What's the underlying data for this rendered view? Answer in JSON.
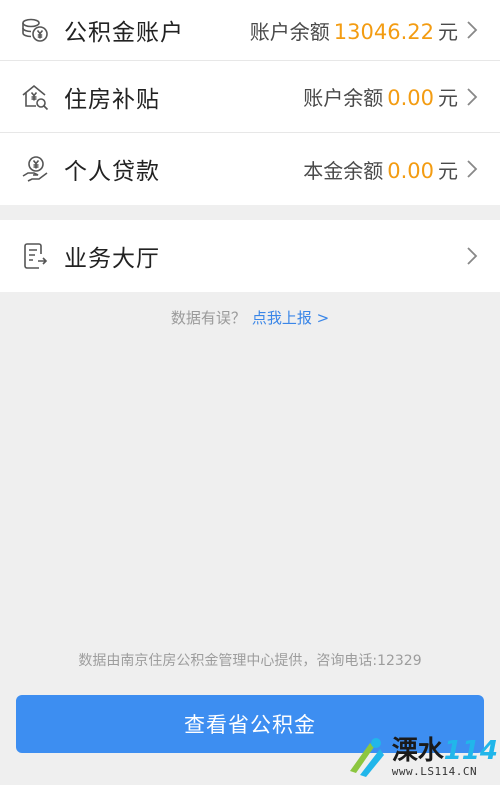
{
  "accounts": [
    {
      "icon": "coins-icon",
      "label": "公积金账户",
      "right_label": "账户余额",
      "amount": "13046.22",
      "unit": "元"
    },
    {
      "icon": "house-subsidy-icon",
      "label": "住房补贴",
      "right_label": "账户余额",
      "amount": "0.00",
      "unit": "元"
    },
    {
      "icon": "loan-hand-icon",
      "label": "个人贷款",
      "right_label": "本金余额",
      "amount": "0.00",
      "unit": "元"
    }
  ],
  "service_hall": {
    "icon": "document-icon",
    "label": "业务大厅"
  },
  "report": {
    "prompt": "数据有误？",
    "link": "点我上报 >"
  },
  "footer_note": "数据由南京住房公积金管理中心提供，咨询电话:12329",
  "primary_button": "查看省公积金",
  "watermark": {
    "title": "溧水",
    "number": "114",
    "url": "www.LS114.CN"
  },
  "colors": {
    "accent": "#3d8ef1",
    "amount": "#f39c12",
    "link": "#3a86e8"
  }
}
